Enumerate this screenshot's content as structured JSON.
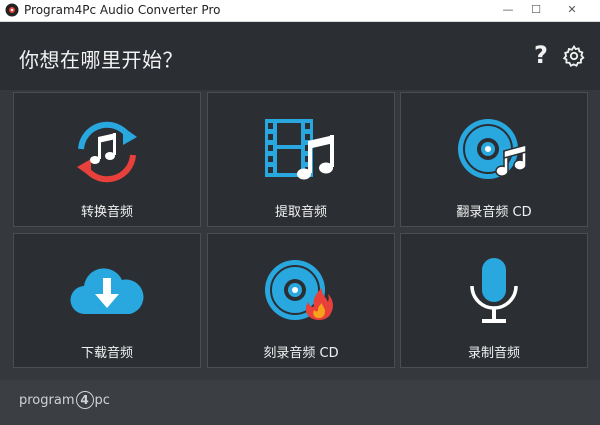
{
  "window": {
    "title": "Program4Pc Audio Converter Pro",
    "minimize_glyph": "—",
    "maximize_glyph": "☐",
    "close_glyph": "✕"
  },
  "header": {
    "headline": "你想在哪里开始？",
    "help_glyph": "?",
    "help_icon": "help-icon",
    "settings_icon": "gear-icon"
  },
  "tiles": [
    {
      "label": "转换音频",
      "icon": "convert-audio-icon"
    },
    {
      "label": "提取音频",
      "icon": "extract-audio-icon"
    },
    {
      "label": "翻录音频 CD",
      "icon": "rip-cd-icon"
    },
    {
      "label": "下载音频",
      "icon": "download-audio-icon"
    },
    {
      "label": "刻录音频 CD",
      "icon": "burn-cd-icon"
    },
    {
      "label": "录制音频",
      "icon": "record-audio-icon"
    }
  ],
  "footer": {
    "logo_prefix": "program",
    "logo_digit": "4",
    "logo_suffix": "pc"
  },
  "colors": {
    "accent": "#29a8e0",
    "red": "#e8413c",
    "background": "#35383d",
    "tile_bg": "#2b2e33"
  }
}
